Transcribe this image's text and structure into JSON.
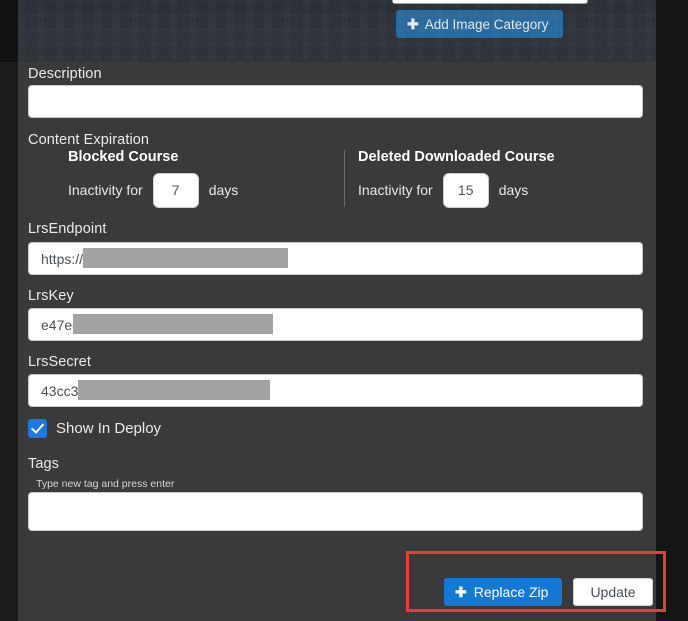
{
  "header": {
    "add_image_category_label": "Add Image Category",
    "plus_icon": "plus-icon"
  },
  "form": {
    "description": {
      "label": "Description",
      "value": "",
      "placeholder": ""
    },
    "content_expiration": {
      "label": "Content Expiration",
      "columns": [
        {
          "title": "Blocked Course",
          "prefix": "Inactivity for",
          "value": "7",
          "suffix": "days"
        },
        {
          "title": "Deleted Downloaded Course",
          "prefix": "Inactivity for",
          "value": "15",
          "suffix": "days"
        }
      ]
    },
    "lrs_endpoint": {
      "label": "LrsEndpoint",
      "value": "https://l",
      "redacted": true
    },
    "lrs_key": {
      "label": "LrsKey",
      "value": "e47ec",
      "redacted": true
    },
    "lrs_secret": {
      "label": "LrsSecret",
      "value": "43cc3",
      "redacted": true
    },
    "show_in_deploy": {
      "label": "Show In Deploy",
      "checked": true
    },
    "tags": {
      "label": "Tags",
      "hint": "Type new tag and press enter",
      "value": "",
      "placeholder": ""
    }
  },
  "actions": {
    "replace_zip_label": "Replace Zip",
    "replace_zip_icon": "plus-icon",
    "update_label": "Update",
    "highlight_color": "#f03a32"
  },
  "colors": {
    "panel_background": "#3a3a3a",
    "top_band": "#2f343b",
    "primary_blue": "#1479d4",
    "muted_blue": "#2a6a9e",
    "checkbox_blue": "#1b79e4",
    "redaction_gray": "#a3a3a3",
    "annotation_red": "#f03a32"
  }
}
